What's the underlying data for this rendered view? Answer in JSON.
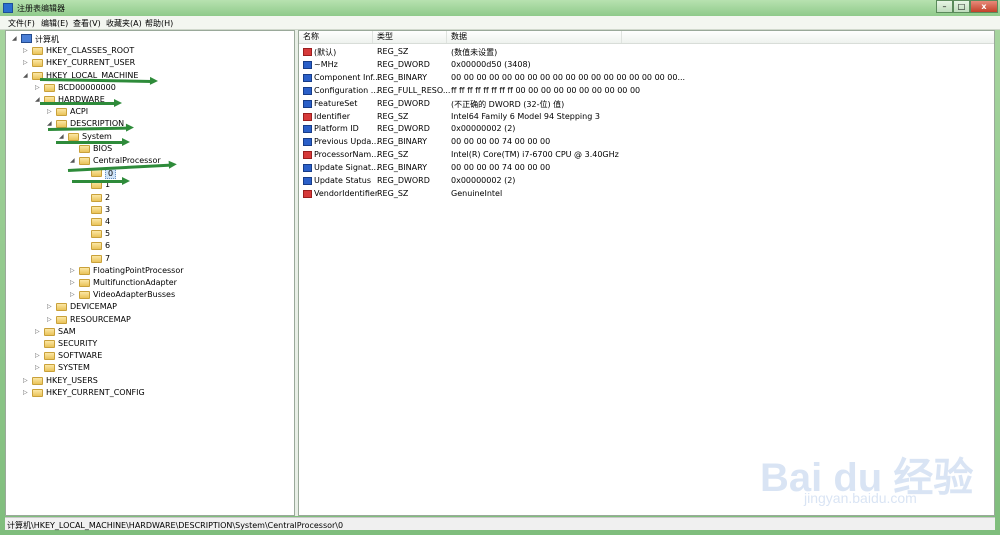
{
  "window": {
    "title": "注册表编辑器",
    "controls": {
      "minimize": "–",
      "maximize": "□",
      "close": "x"
    }
  },
  "menu": [
    "文件(F)",
    "编辑(E)",
    "查看(V)",
    "收藏夹(A)",
    "帮助(H)"
  ],
  "tree": [
    {
      "label": "计算机",
      "depth": 0,
      "toggle": "◢",
      "kind": "computer"
    },
    {
      "label": "HKEY_CLASSES_ROOT",
      "depth": 1,
      "toggle": "▷"
    },
    {
      "label": "HKEY_CURRENT_USER",
      "depth": 1,
      "toggle": "▷"
    },
    {
      "label": "HKEY_LOCAL_MACHINE",
      "depth": 1,
      "toggle": "◢"
    },
    {
      "label": "BCD00000000",
      "depth": 2,
      "toggle": "▷"
    },
    {
      "label": "HARDWARE",
      "depth": 2,
      "toggle": "◢"
    },
    {
      "label": "ACPI",
      "depth": 3,
      "toggle": "▷"
    },
    {
      "label": "DESCRIPTION",
      "depth": 3,
      "toggle": "◢"
    },
    {
      "label": "System",
      "depth": 4,
      "toggle": "◢"
    },
    {
      "label": "BIOS",
      "depth": 5,
      "toggle": ""
    },
    {
      "label": "CentralProcessor",
      "depth": 5,
      "toggle": "◢"
    },
    {
      "label": "0",
      "depth": 6,
      "toggle": "",
      "selected": true
    },
    {
      "label": "1",
      "depth": 6,
      "toggle": ""
    },
    {
      "label": "2",
      "depth": 6,
      "toggle": ""
    },
    {
      "label": "3",
      "depth": 6,
      "toggle": ""
    },
    {
      "label": "4",
      "depth": 6,
      "toggle": ""
    },
    {
      "label": "5",
      "depth": 6,
      "toggle": ""
    },
    {
      "label": "6",
      "depth": 6,
      "toggle": ""
    },
    {
      "label": "7",
      "depth": 6,
      "toggle": ""
    },
    {
      "label": "FloatingPointProcessor",
      "depth": 5,
      "toggle": "▷"
    },
    {
      "label": "MultifunctionAdapter",
      "depth": 5,
      "toggle": "▷"
    },
    {
      "label": "VideoAdapterBusses",
      "depth": 5,
      "toggle": "▷"
    },
    {
      "label": "DEVICEMAP",
      "depth": 3,
      "toggle": "▷"
    },
    {
      "label": "RESOURCEMAP",
      "depth": 3,
      "toggle": "▷"
    },
    {
      "label": "SAM",
      "depth": 2,
      "toggle": "▷"
    },
    {
      "label": "SECURITY",
      "depth": 2,
      "toggle": ""
    },
    {
      "label": "SOFTWARE",
      "depth": 2,
      "toggle": "▷"
    },
    {
      "label": "SYSTEM",
      "depth": 2,
      "toggle": "▷"
    },
    {
      "label": "HKEY_USERS",
      "depth": 1,
      "toggle": "▷"
    },
    {
      "label": "HKEY_CURRENT_CONFIG",
      "depth": 1,
      "toggle": "▷"
    }
  ],
  "columns": [
    "名称",
    "类型",
    "数据"
  ],
  "values": [
    {
      "name": "(默认)",
      "type": "REG_SZ",
      "data": "(数值未设置)",
      "icon": "ab"
    },
    {
      "name": "~MHz",
      "type": "REG_DWORD",
      "data": "0x00000d50 (3408)",
      "icon": "bin"
    },
    {
      "name": "Component Inf...",
      "type": "REG_BINARY",
      "data": "00 00 00 00 00 00 00 00 00 00 00 00 00 00 00 00 00 00...",
      "icon": "bin"
    },
    {
      "name": "Configuration ...",
      "type": "REG_FULL_RESO...",
      "data": "ff ff ff ff ff ff ff ff 00 00 00 00 00 00 00 00 00 00",
      "icon": "bin"
    },
    {
      "name": "FeatureSet",
      "type": "REG_DWORD",
      "data": "(不正确的 DWORD (32-位) 值)",
      "icon": "bin"
    },
    {
      "name": "Identifier",
      "type": "REG_SZ",
      "data": "Intel64 Family 6 Model 94 Stepping 3",
      "icon": "ab"
    },
    {
      "name": "Platform ID",
      "type": "REG_DWORD",
      "data": "0x00000002 (2)",
      "icon": "bin"
    },
    {
      "name": "Previous Upda...",
      "type": "REG_BINARY",
      "data": "00 00 00 00 74 00 00 00",
      "icon": "bin"
    },
    {
      "name": "ProcessorNam...",
      "type": "REG_SZ",
      "data": "Intel(R) Core(TM) i7-6700 CPU @ 3.40GHz",
      "icon": "ab"
    },
    {
      "name": "Update Signat...",
      "type": "REG_BINARY",
      "data": "00 00 00 00 74 00 00 00",
      "icon": "bin"
    },
    {
      "name": "Update Status",
      "type": "REG_DWORD",
      "data": "0x00000002 (2)",
      "icon": "bin"
    },
    {
      "name": "VendorIdentifier",
      "type": "REG_SZ",
      "data": "GenuineIntel",
      "icon": "ab"
    }
  ],
  "status_path": "计算机\\HKEY_LOCAL_MACHINE\\HARDWARE\\DESCRIPTION\\System\\CentralProcessor\\0",
  "watermark": {
    "text": "Bai du 经验",
    "sub": "jingyan.baidu.com"
  },
  "colors": {
    "arrow": "#2e8b3a",
    "selection": "#cfe3f8"
  }
}
